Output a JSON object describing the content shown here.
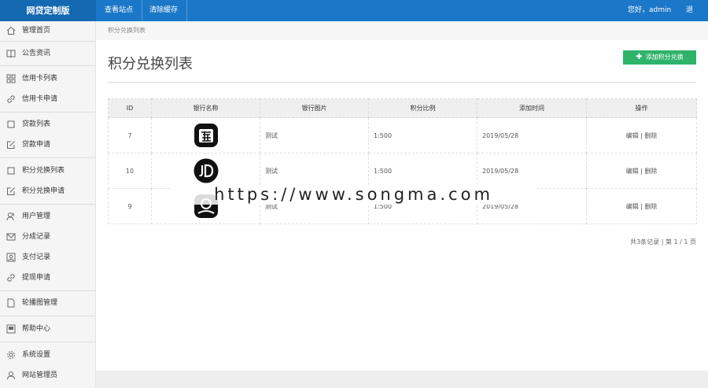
{
  "header": {
    "brand": "网贷定制版",
    "links": [
      "查看站点",
      "清除缓存"
    ],
    "greeting": "您好，admin",
    "logout": "退出"
  },
  "sidebar": {
    "items": [
      {
        "label": "管理首页",
        "icon": "home-icon"
      },
      {
        "label": "公告资讯",
        "icon": "book-icon"
      },
      {
        "label": "信用卡列表",
        "icon": "grid-icon"
      },
      {
        "label": "信用卡申请",
        "icon": "link-icon"
      },
      {
        "label": "贷款列表",
        "icon": "square-icon"
      },
      {
        "label": "贷款申请",
        "icon": "edit-icon"
      },
      {
        "label": "积分兑换列表",
        "icon": "square-icon"
      },
      {
        "label": "积分兑换申请",
        "icon": "edit-icon"
      },
      {
        "label": "用户管理",
        "icon": "users-icon"
      },
      {
        "label": "分成记录",
        "icon": "mail-icon"
      },
      {
        "label": "支付记录",
        "icon": "picture-icon"
      },
      {
        "label": "提现申请",
        "icon": "link-icon"
      },
      {
        "label": "轮播图管理",
        "icon": "file-icon"
      },
      {
        "label": "帮助中心",
        "icon": "window-icon"
      },
      {
        "label": "系统设置",
        "icon": "gear-icon"
      },
      {
        "label": "网站管理员",
        "icon": "user-icon"
      }
    ]
  },
  "main": {
    "breadcrumb": "积分兑换列表",
    "title": "积分兑换列表",
    "add_button": "添加积分兑换"
  },
  "table": {
    "columns": [
      "ID",
      "银行名称",
      "银行图片",
      "积分比例",
      "添加时间",
      "操作"
    ],
    "rows": [
      {
        "id": "7",
        "logo": "taobao-logo",
        "image": "测试",
        "ratio": "1:500",
        "date": "2019/05/28",
        "edit": "编辑",
        "sep": " | ",
        "del": "删除"
      },
      {
        "id": "10",
        "logo": "jd-logo",
        "image": "测试",
        "ratio": "1:500",
        "date": "2019/05/28",
        "edit": "编辑",
        "sep": " | ",
        "del": "删除"
      },
      {
        "id": "9",
        "logo": "dark-logo",
        "image": "测试",
        "ratio": "1:500",
        "date": "2019/05/28",
        "edit": "编辑",
        "sep": " | ",
        "del": "删除"
      }
    ]
  },
  "pagination": "共3条记录 | 第 1 / 1 页",
  "watermark": "https://www.songma.com",
  "colors": {
    "topbar": "#1b78c8",
    "brand": "#1569b2",
    "add_button": "#2fb36a"
  }
}
